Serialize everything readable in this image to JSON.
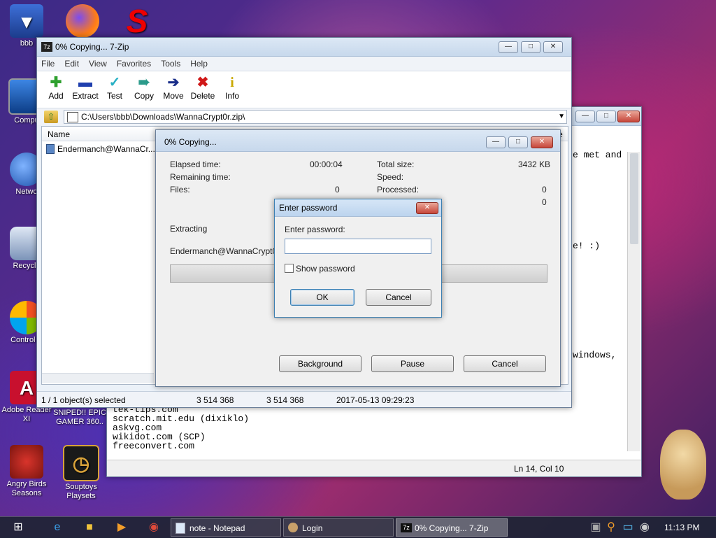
{
  "desktop": {
    "icons": [
      {
        "label": "bbb"
      },
      {
        "label": "Compu"
      },
      {
        "label": "Netwo"
      },
      {
        "label": "Recycle"
      },
      {
        "label": "Control P"
      },
      {
        "label": "Adobe Reader XI"
      },
      {
        "label": "SNIPED!! EPIC GAMER 360.."
      },
      {
        "label": "Angry Birds Seasons"
      },
      {
        "label": "Souptoys Playsets"
      }
    ]
  },
  "notepad": {
    "text_right": [
      "e met and",
      "e! :)",
      "windows,"
    ],
    "lines": [
      "tek-tips.com",
      "scratch.mit.edu (dixiklo)",
      "askvg.com",
      "wikidot.com (SCP)",
      "freeconvert.com"
    ],
    "status": "Ln 14, Col 10"
  },
  "sevenzip": {
    "title": "0% Copying... 7-Zip",
    "menu": [
      "File",
      "Edit",
      "View",
      "Favorites",
      "Tools",
      "Help"
    ],
    "toolbar": [
      "Add",
      "Extract",
      "Test",
      "Copy",
      "Move",
      "Delete",
      "Info"
    ],
    "path": "C:\\Users\\bbb\\Downloads\\WannaCrypt0r.zip\\",
    "column_name": "Name",
    "column_right": "e",
    "file": "Endermanch@WannaCr...",
    "status": {
      "selected": "1 / 1 object(s) selected",
      "size": "3 514 368",
      "packed": "3 514 368",
      "modified": "2017-05-13 09:29:23"
    }
  },
  "progress": {
    "title": "0% Copying...",
    "elapsed_label": "Elapsed time:",
    "elapsed_value": "00:00:04",
    "remaining_label": "Remaining time:",
    "files_label": "Files:",
    "files_value": "0",
    "total_label": "Total size:",
    "total_value": "3432 KB",
    "speed_label": "Speed:",
    "processed_label": "Processed:",
    "processed_value": "0",
    "extra_value": "0",
    "extracting_label": "Extracting",
    "current_file": "Endermanch@WannaCrypt0r.ex",
    "progress_fraction": 0,
    "buttons": {
      "background": "Background",
      "pause": "Pause",
      "cancel": "Cancel"
    }
  },
  "password_dialog": {
    "title": "Enter password",
    "prompt": "Enter password:",
    "value": "",
    "show_password": "Show password",
    "ok": "OK",
    "cancel": "Cancel"
  },
  "taskbar": {
    "tasks": [
      {
        "label": "note - Notepad"
      },
      {
        "label": "Login"
      },
      {
        "label": "0% Copying... 7-Zip"
      }
    ],
    "clock": "11:13 PM"
  },
  "colors": {
    "accent": "#3c7fb1",
    "close_red": "#c7463a",
    "taskbar": "#1e2434"
  }
}
